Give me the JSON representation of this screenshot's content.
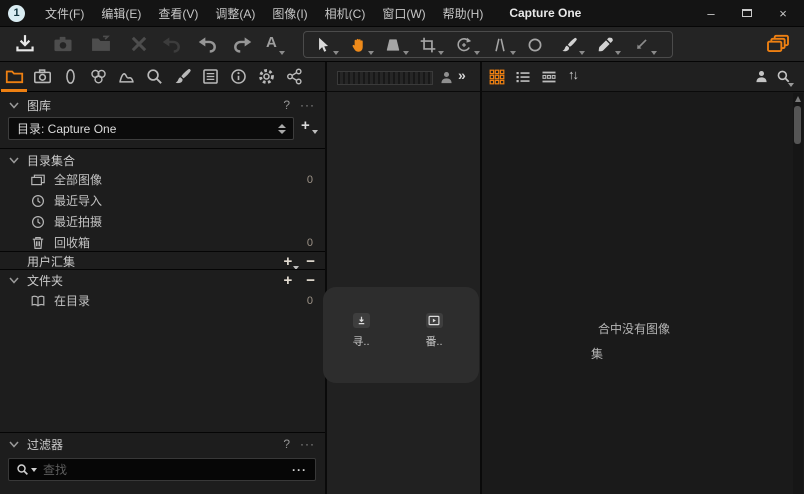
{
  "window": {
    "title": "Capture One",
    "minimize_glyph": "–",
    "close_glyph": "×"
  },
  "menu": {
    "items": [
      "文件(F)",
      "编辑(E)",
      "查看(V)",
      "调整(A)",
      "图像(I)",
      "相机(C)",
      "窗口(W)",
      "帮助(H)"
    ]
  },
  "toolbar": {
    "left_icons": [
      "import",
      "capture",
      "open-session",
      "delete",
      "undo-alt",
      "undo",
      "redo",
      "annotations"
    ],
    "annotations_glyph": "A",
    "cursor_tools": [
      "select",
      "pan",
      "loupe",
      "crop",
      "rotate",
      "keystone",
      "spot",
      "draw-mask",
      "pick-color",
      "apply-adjustments"
    ],
    "active_cursor_tool": "pan",
    "right_icon": "browser-toggle"
  },
  "tool_tabs": [
    "library",
    "capture",
    "lens",
    "color",
    "exposure",
    "details",
    "adjustments",
    "metadata",
    "info",
    "settings",
    "workflow"
  ],
  "library": {
    "title": "图库",
    "help": "?",
    "more": "···",
    "selector": {
      "value": "目录: Capture One",
      "add": "+"
    },
    "catalog": {
      "title": "目录集合",
      "rows": [
        {
          "icon": "all-images",
          "label": "全部图像",
          "count": "0"
        },
        {
          "icon": "clock",
          "label": "最近导入",
          "count": ""
        },
        {
          "icon": "clock",
          "label": "最近拍摄",
          "count": ""
        },
        {
          "icon": "trash",
          "label": "回收箱",
          "count": "0"
        }
      ]
    },
    "user_collections": {
      "title": "用户汇集",
      "add": "+",
      "remove": "−"
    },
    "folders": {
      "title": "文件夹",
      "add": "+",
      "remove": "−",
      "rows": [
        {
          "icon": "open-book",
          "label": "在目录",
          "count": "0"
        }
      ]
    }
  },
  "filters": {
    "title": "过滤器",
    "help": "?",
    "more": "···",
    "search_placeholder": "查找",
    "search_more": "···"
  },
  "viewer": {
    "overlay_buttons": [
      {
        "icon": "import",
        "label": "寻.."
      },
      {
        "icon": "play",
        "label": "番.."
      }
    ]
  },
  "browser": {
    "collapse_glyph": "»",
    "sort_glyph": "↑↓",
    "empty_line1": "合中没有图像",
    "empty_line2": "集"
  },
  "colors": {
    "accent": "#ee8012",
    "panel_bg": "#1d1d1d",
    "toolbar_bg": "#242424"
  }
}
